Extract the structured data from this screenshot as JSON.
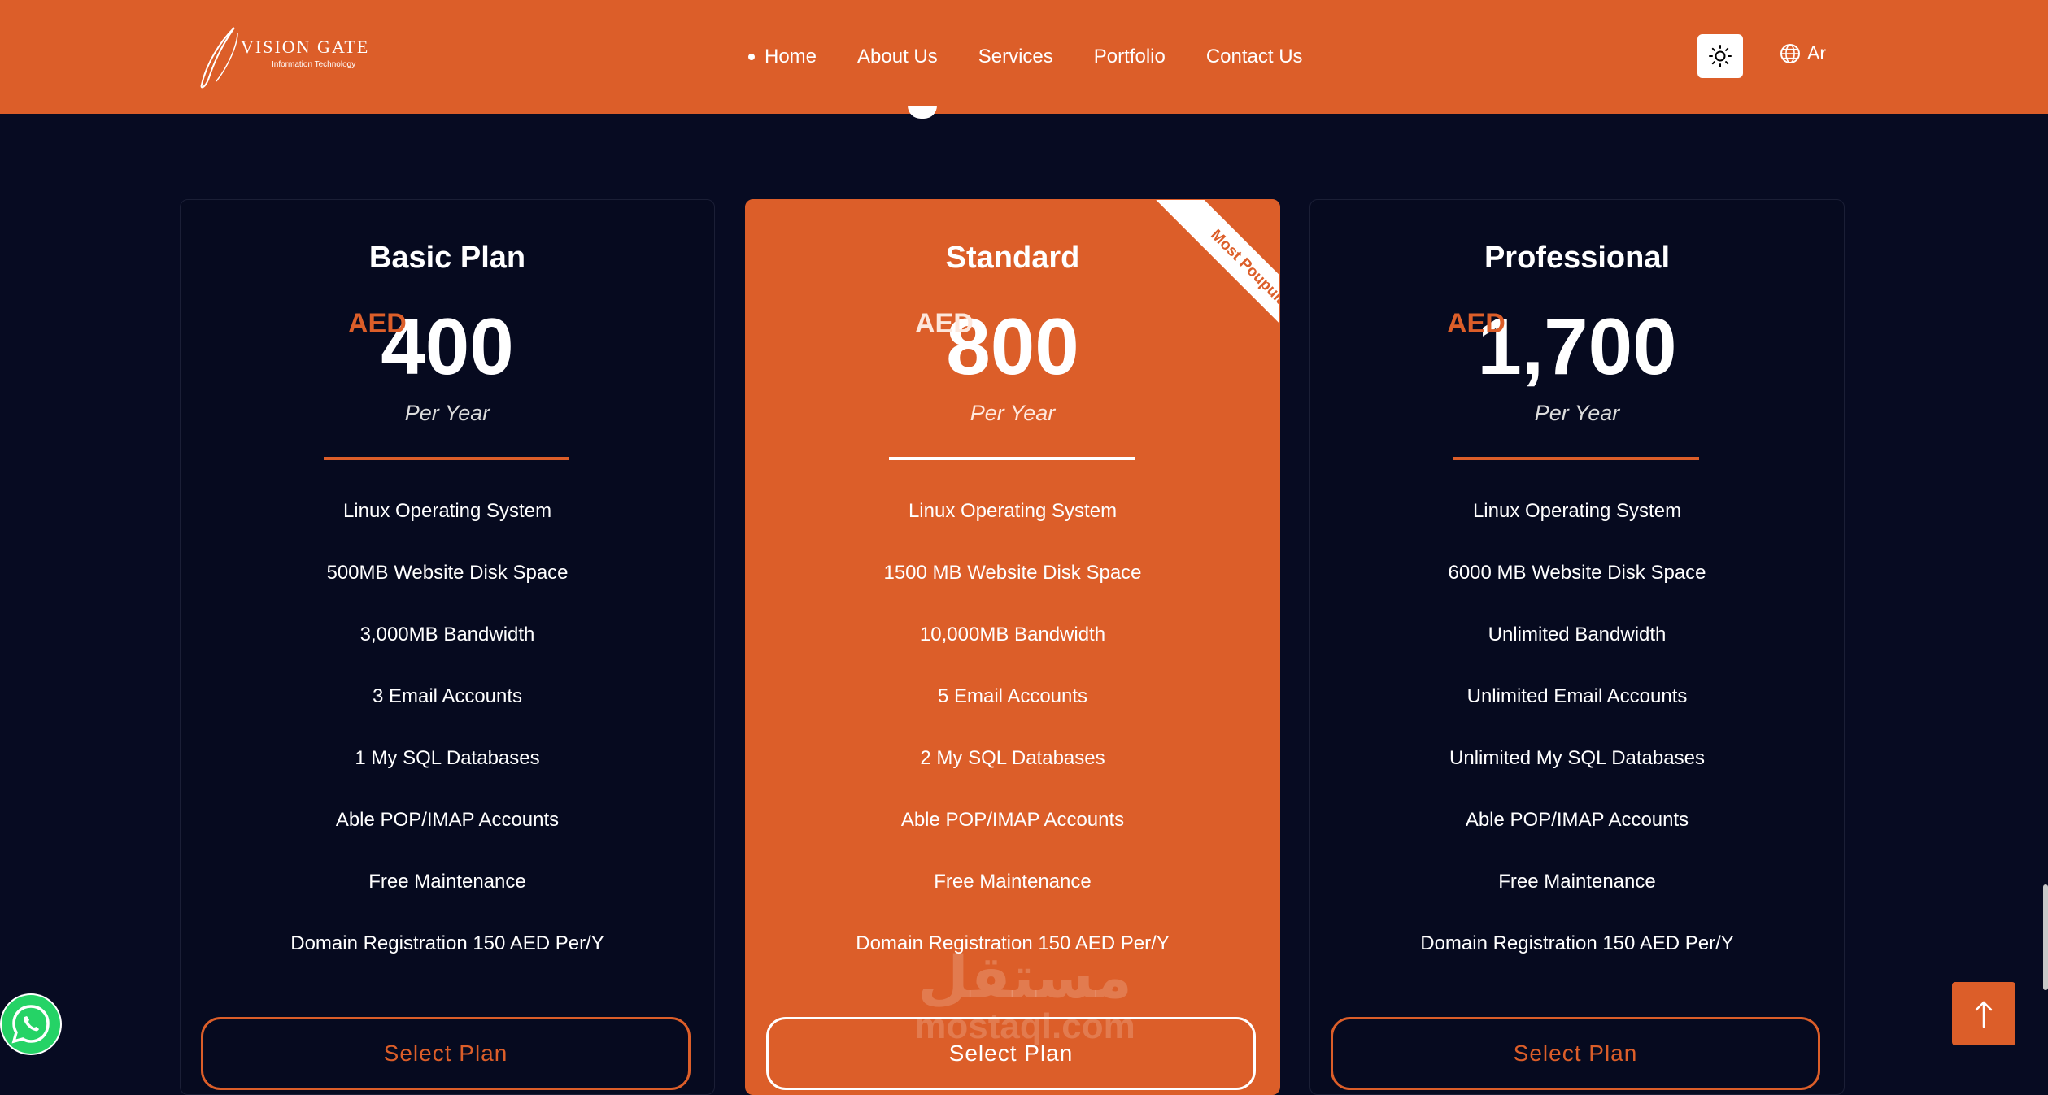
{
  "colors": {
    "accent": "#dc5e29",
    "background": "#070b22",
    "text": "#ffffff"
  },
  "header": {
    "logo": {
      "title": "VISION GATE",
      "subtitle": "Information Technology"
    },
    "nav": [
      {
        "label": "Home",
        "active": true
      },
      {
        "label": "About Us"
      },
      {
        "label": "Services"
      },
      {
        "label": "Portfolio"
      },
      {
        "label": "Contact Us"
      }
    ],
    "theme_toggle_icon": "sun-icon",
    "language": {
      "icon": "globe-icon",
      "label": "Ar"
    }
  },
  "plans": [
    {
      "name": "Basic Plan",
      "currency": "AED",
      "price": "400",
      "period": "Per Year",
      "features": [
        "Linux Operating System",
        "500MB Website Disk Space",
        "3,000MB Bandwidth",
        "3 Email Accounts",
        "1 My SQL Databases",
        "Able POP/IMAP Accounts",
        "Free Maintenance",
        "Domain Registration 150 AED Per/Y"
      ],
      "button": "Select Plan"
    },
    {
      "name": "Standard",
      "currency": "AED",
      "price": "800",
      "period": "Per Year",
      "badge": "Most Poupular",
      "features": [
        "Linux Operating System",
        "1500 MB Website Disk Space",
        "10,000MB Bandwidth",
        "5 Email Accounts",
        "2 My SQL Databases",
        "Able POP/IMAP Accounts",
        "Free Maintenance",
        "Domain Registration 150 AED Per/Y"
      ],
      "button": "Select Plan"
    },
    {
      "name": "Professional",
      "currency": "AED",
      "price": "1,700",
      "period": "Per Year",
      "features": [
        "Linux Operating System",
        "6000 MB Website Disk Space",
        "Unlimited Bandwidth",
        "Unlimited Email Accounts",
        "Unlimited My SQL Databases",
        "Able POP/IMAP Accounts",
        "Free Maintenance",
        "Domain Registration 150 AED Per/Y"
      ],
      "button": "Select Plan"
    }
  ],
  "watermark": {
    "arabic": "مستقل",
    "latin": "mostaql.com"
  },
  "floating": {
    "whatsapp_icon": "whatsapp-icon",
    "scroll_top_icon": "arrow-up-icon"
  }
}
